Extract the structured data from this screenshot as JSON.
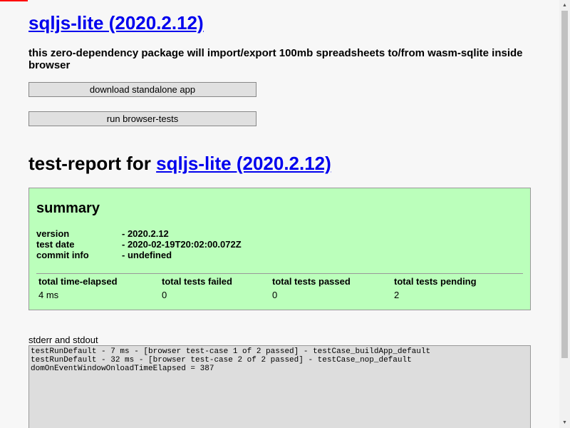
{
  "header": {
    "title_link": "sqljs-lite (2020.2.12)",
    "tagline": "this zero-dependency package will import/export 100mb spreadsheets to/from wasm-sqlite inside browser"
  },
  "buttons": {
    "download": "download standalone app",
    "run_tests": "run browser-tests"
  },
  "report": {
    "heading_prefix": "test-report for ",
    "heading_link": "sqljs-lite (2020.2.12)"
  },
  "summary": {
    "title": "summary",
    "info": [
      {
        "key": "version",
        "value": "- 2020.2.12"
      },
      {
        "key": "test date",
        "value": "- 2020-02-19T20:02:00.072Z"
      },
      {
        "key": "commit info",
        "value": "- undefined"
      }
    ],
    "totals_headers": [
      "total time-elapsed",
      "total tests failed",
      "total tests passed",
      "total tests pending"
    ],
    "totals_values": [
      "4 ms",
      "0",
      "0",
      "2"
    ]
  },
  "stdio": {
    "label": "stderr and stdout",
    "lines": [
      "testRunDefault - 7 ms - [browser test-case 1 of 2 passed] - testCase_buildApp_default",
      "testRunDefault - 32 ms - [browser test-case 2 of 2 passed] - testCase_nop_default",
      "domOnEventWindowOnloadTimeElapsed = 387"
    ]
  },
  "colors": {
    "summary_background": "#bbffbb",
    "link": "#0000ee",
    "progress": "#ff0000"
  }
}
